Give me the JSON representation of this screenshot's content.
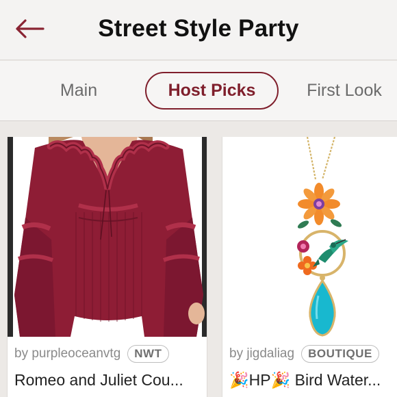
{
  "header": {
    "title": "Street Style Party",
    "back_icon": "arrow-left-icon",
    "accent_color": "#7f1f2c"
  },
  "tabs": [
    {
      "label": "Main",
      "active": false
    },
    {
      "label": "Host Picks",
      "active": true
    },
    {
      "label": "First Look",
      "active": false
    }
  ],
  "listings": [
    {
      "seller": "by purpleoceanvtg",
      "badge": "NWT",
      "title": "Romeo and Juliet Cou...",
      "image": "burgundy ruffle blouse"
    },
    {
      "seller": "by jigdaliag",
      "badge": "BOUTIQUE",
      "title": "🎉HP🎉 Bird Water...",
      "image": "hummingbird flower pendant necklace"
    }
  ]
}
